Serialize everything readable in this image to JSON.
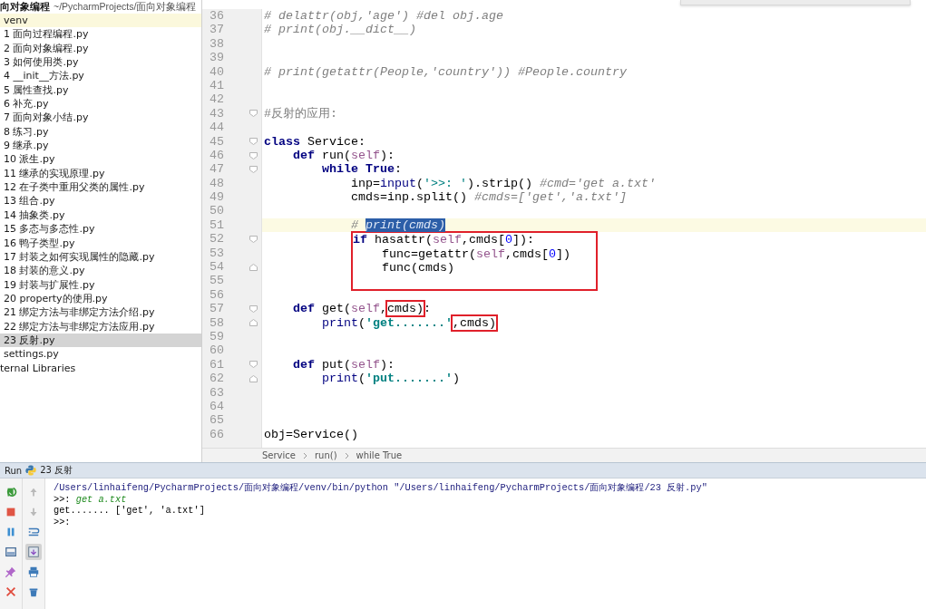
{
  "project": {
    "name": "向对象编程",
    "path": "~/PycharmProjects/面向对象编程"
  },
  "tree": [
    {
      "label": "venv",
      "kind": "folder",
      "selected": false,
      "highlighted": true
    },
    {
      "label": "1 面向过程编程.py",
      "kind": "file",
      "selected": false
    },
    {
      "label": "2 面向对象编程.py",
      "kind": "file",
      "selected": false
    },
    {
      "label": "3 如何使用类.py",
      "kind": "file",
      "selected": false
    },
    {
      "label": "4 __init__方法.py",
      "kind": "file",
      "selected": false
    },
    {
      "label": "5 属性查找.py",
      "kind": "file",
      "selected": false
    },
    {
      "label": "6 补充.py",
      "kind": "file",
      "selected": false
    },
    {
      "label": "7 面向对象小结.py",
      "kind": "file",
      "selected": false
    },
    {
      "label": "8 练习.py",
      "kind": "file",
      "selected": false
    },
    {
      "label": "9 继承.py",
      "kind": "file",
      "selected": false
    },
    {
      "label": "10 派生.py",
      "kind": "file",
      "selected": false
    },
    {
      "label": "11 继承的实现原理.py",
      "kind": "file",
      "selected": false
    },
    {
      "label": "12 在子类中重用父类的属性.py",
      "kind": "file",
      "selected": false
    },
    {
      "label": "13 组合.py",
      "kind": "file",
      "selected": false
    },
    {
      "label": "14 抽象类.py",
      "kind": "file",
      "selected": false
    },
    {
      "label": "15 多态与多态性.py",
      "kind": "file",
      "selected": false
    },
    {
      "label": "16 鸭子类型.py",
      "kind": "file",
      "selected": false
    },
    {
      "label": "17 封装之如何实现属性的隐藏.py",
      "kind": "file",
      "selected": false
    },
    {
      "label": "18 封装的意义.py",
      "kind": "file",
      "selected": false
    },
    {
      "label": "19 封装与扩展性.py",
      "kind": "file",
      "selected": false
    },
    {
      "label": "20 property的使用.py",
      "kind": "file",
      "selected": false
    },
    {
      "label": "21 绑定方法与非绑定方法介绍.py",
      "kind": "file",
      "selected": false
    },
    {
      "label": "22 绑定方法与非绑定方法应用.py",
      "kind": "file",
      "selected": false
    },
    {
      "label": "23 反射.py",
      "kind": "file",
      "selected": true
    },
    {
      "label": "settings.py",
      "kind": "file",
      "selected": false
    },
    {
      "label": "ternal Libraries",
      "kind": "library",
      "selected": false
    }
  ],
  "editor": {
    "lines": [
      {
        "number": "36",
        "tokens": [
          {
            "text": "# delattr(obj,'age') #del obj.age",
            "kind": "comment"
          }
        ]
      },
      {
        "number": "37",
        "tokens": [
          {
            "text": "# print(obj.__dict__)",
            "kind": "comment"
          }
        ]
      },
      {
        "number": "38"
      },
      {
        "number": "39"
      },
      {
        "number": "40",
        "tokens": [
          {
            "text": "# print(getattr(People,'country')) #People.country",
            "kind": "comment"
          }
        ]
      },
      {
        "number": "41"
      },
      {
        "number": "42"
      },
      {
        "number": "43",
        "fold_open": true,
        "tokens": [
          {
            "text": "#反射的应用:",
            "kind": "comment_plain"
          }
        ]
      },
      {
        "number": "44"
      },
      {
        "number": "45",
        "fold_open": true,
        "tokens": [
          {
            "text": "class",
            "kind": "keyword"
          },
          {
            "text": " Service:",
            "kind": "plain"
          }
        ]
      },
      {
        "number": "46",
        "fold_open": true,
        "tokens": [
          {
            "text": "    def",
            "kind": "keyword"
          },
          {
            "text": " run(",
            "kind": "plain"
          },
          {
            "text": "self",
            "kind": "self"
          },
          {
            "text": "):",
            "kind": "plain"
          }
        ]
      },
      {
        "number": "47",
        "fold_open": true,
        "tokens": [
          {
            "text": "        while True",
            "kind": "keyword"
          },
          {
            "text": ":",
            "kind": "plain"
          }
        ]
      },
      {
        "number": "48",
        "tokens": [
          {
            "text": "            inp=",
            "kind": "plain"
          },
          {
            "text": "input",
            "kind": "builtin"
          },
          {
            "text": "(",
            "kind": "plain"
          },
          {
            "text": "'>>: '",
            "kind": "string_plain"
          },
          {
            "text": ").strip() ",
            "kind": "plain"
          },
          {
            "text": "#cmd='get a.txt'",
            "kind": "comment"
          }
        ]
      },
      {
        "number": "49",
        "tokens": [
          {
            "text": "            cmds=inp.split() ",
            "kind": "plain"
          },
          {
            "text": "#cmds=['get','a.txt']",
            "kind": "comment"
          }
        ]
      },
      {
        "number": "50"
      },
      {
        "number": "51",
        "current": true,
        "tokens": [
          {
            "text": "            # ",
            "kind": "comment"
          },
          {
            "text": "print(cmds)",
            "kind": "comment",
            "selected": true
          }
        ]
      },
      {
        "number": "52",
        "fold_open": true,
        "boxed": true,
        "tokens": [
          {
            "text": "if",
            "kind": "keyword"
          },
          {
            "text": " hasattr(",
            "kind": "plain"
          },
          {
            "text": "self",
            "kind": "self"
          },
          {
            "text": ",cmds[",
            "kind": "plain"
          },
          {
            "text": "0",
            "kind": "number"
          },
          {
            "text": "]):",
            "kind": "plain"
          }
        ]
      },
      {
        "number": "53",
        "boxed": true,
        "tokens": [
          {
            "text": "    func=getattr(",
            "kind": "plain"
          },
          {
            "text": "self",
            "kind": "self"
          },
          {
            "text": ",cmds[",
            "kind": "plain"
          },
          {
            "text": "0",
            "kind": "number"
          },
          {
            "text": "])",
            "kind": "plain"
          }
        ]
      },
      {
        "number": "54",
        "fold_close": true,
        "boxed": true,
        "tokens": [
          {
            "text": "    func(cmds)",
            "kind": "plain"
          }
        ]
      },
      {
        "number": "55",
        "boxed": true
      },
      {
        "number": "56"
      },
      {
        "number": "57",
        "fold_open": true,
        "tokens": [
          {
            "text": "    def",
            "kind": "keyword"
          },
          {
            "text": " get(",
            "kind": "plain"
          },
          {
            "text": "self",
            "kind": "self"
          },
          {
            "text": ",",
            "kind": "plain"
          },
          {
            "text": "cmds)",
            "kind": "plain",
            "boxed": true
          },
          {
            "text": ":",
            "kind": "plain"
          }
        ]
      },
      {
        "number": "58",
        "fold_close": true,
        "tokens": [
          {
            "text": "        print",
            "kind": "builtin"
          },
          {
            "text": "(",
            "kind": "plain"
          },
          {
            "text": "'get.......'",
            "kind": "string"
          },
          {
            "text": ",cmds)",
            "kind": "plain",
            "boxed": true
          }
        ]
      },
      {
        "number": "59"
      },
      {
        "number": "60"
      },
      {
        "number": "61",
        "fold_open": true,
        "tokens": [
          {
            "text": "    def",
            "kind": "keyword"
          },
          {
            "text": " put(",
            "kind": "plain"
          },
          {
            "text": "self",
            "kind": "self"
          },
          {
            "text": "):",
            "kind": "plain"
          }
        ]
      },
      {
        "number": "62",
        "fold_close": true,
        "tokens": [
          {
            "text": "        print",
            "kind": "builtin"
          },
          {
            "text": "(",
            "kind": "plain"
          },
          {
            "text": "'put.......'",
            "kind": "string"
          },
          {
            "text": ")",
            "kind": "plain"
          }
        ]
      },
      {
        "number": "63"
      },
      {
        "number": "64"
      },
      {
        "number": "65"
      },
      {
        "number": "66",
        "tokens": [
          {
            "text": "obj=Service()",
            "kind": "plain"
          }
        ]
      }
    ],
    "breadcrumbs": [
      "Service",
      "run()",
      "while True"
    ]
  },
  "run": {
    "label": "Run",
    "config": "23 反射",
    "console": [
      {
        "kind": "command",
        "text": "/Users/linhaifeng/PycharmProjects/面向对象编程/venv/bin/python \"/Users/linhaifeng/PycharmProjects/面向对象编程/23 反射.py\""
      },
      {
        "kind": "prompt",
        "text": ">>:",
        "input": "get a.txt"
      },
      {
        "kind": "output",
        "text": "get....... ['get', 'a.txt']"
      },
      {
        "kind": "prompt",
        "text": ">>:"
      }
    ]
  }
}
